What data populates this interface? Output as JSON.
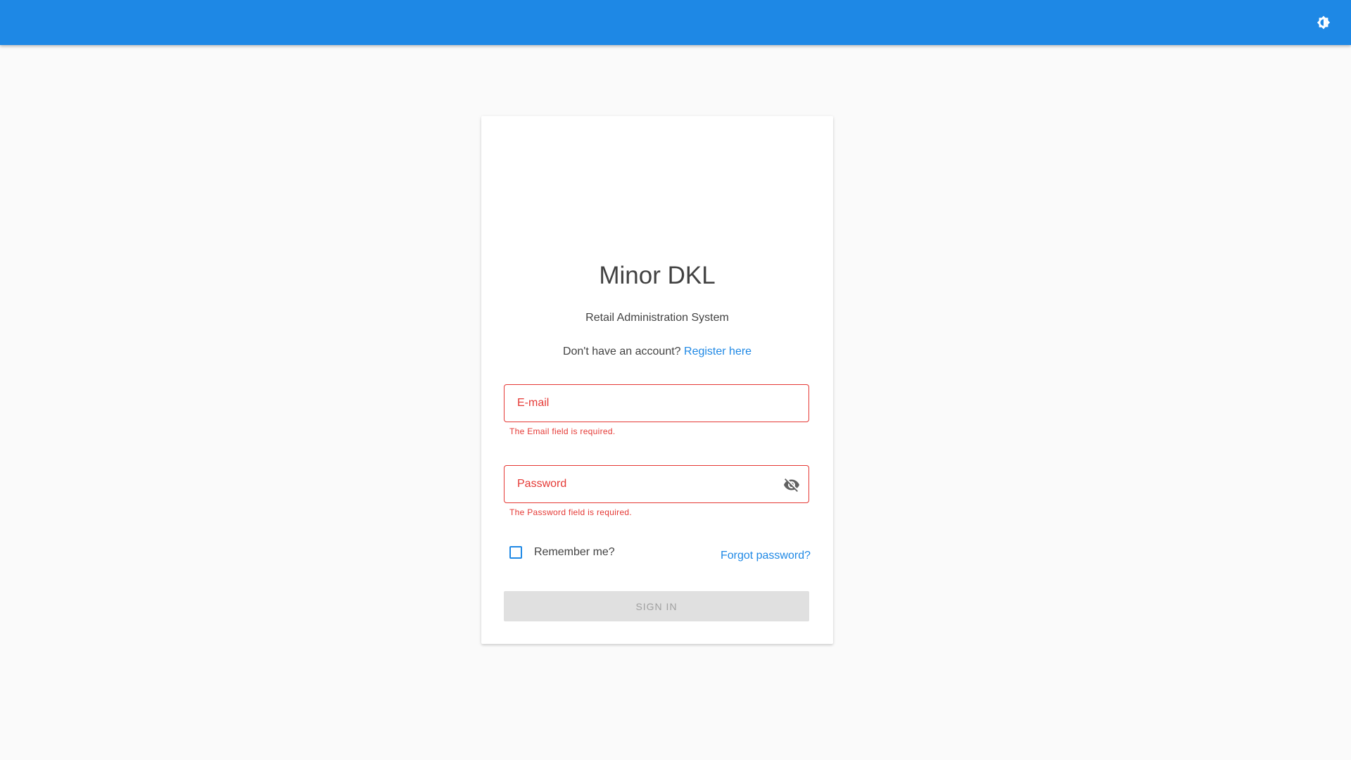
{
  "header": {
    "theme_toggle_icon": "brightness-icon",
    "color": "#1e88e5"
  },
  "login": {
    "title": "Minor DKL",
    "subtitle": "Retail Administration System",
    "no_account_text": "Don't have an account?",
    "register_link": "Register here",
    "email": {
      "label": "E-mail",
      "value": "",
      "error": "The Email field is required."
    },
    "password": {
      "label": "Password",
      "value": "",
      "error": "The Password field is required.",
      "toggle_icon": "eye-off-icon"
    },
    "remember_label": "Remember me?",
    "remember_checked": false,
    "forgot_link": "Forgot password?",
    "signin_label": "SIGN IN",
    "signin_disabled": true
  },
  "colors": {
    "primary": "#1e88e5",
    "error": "#e53935",
    "text": "#424242",
    "background": "#fafafa"
  }
}
